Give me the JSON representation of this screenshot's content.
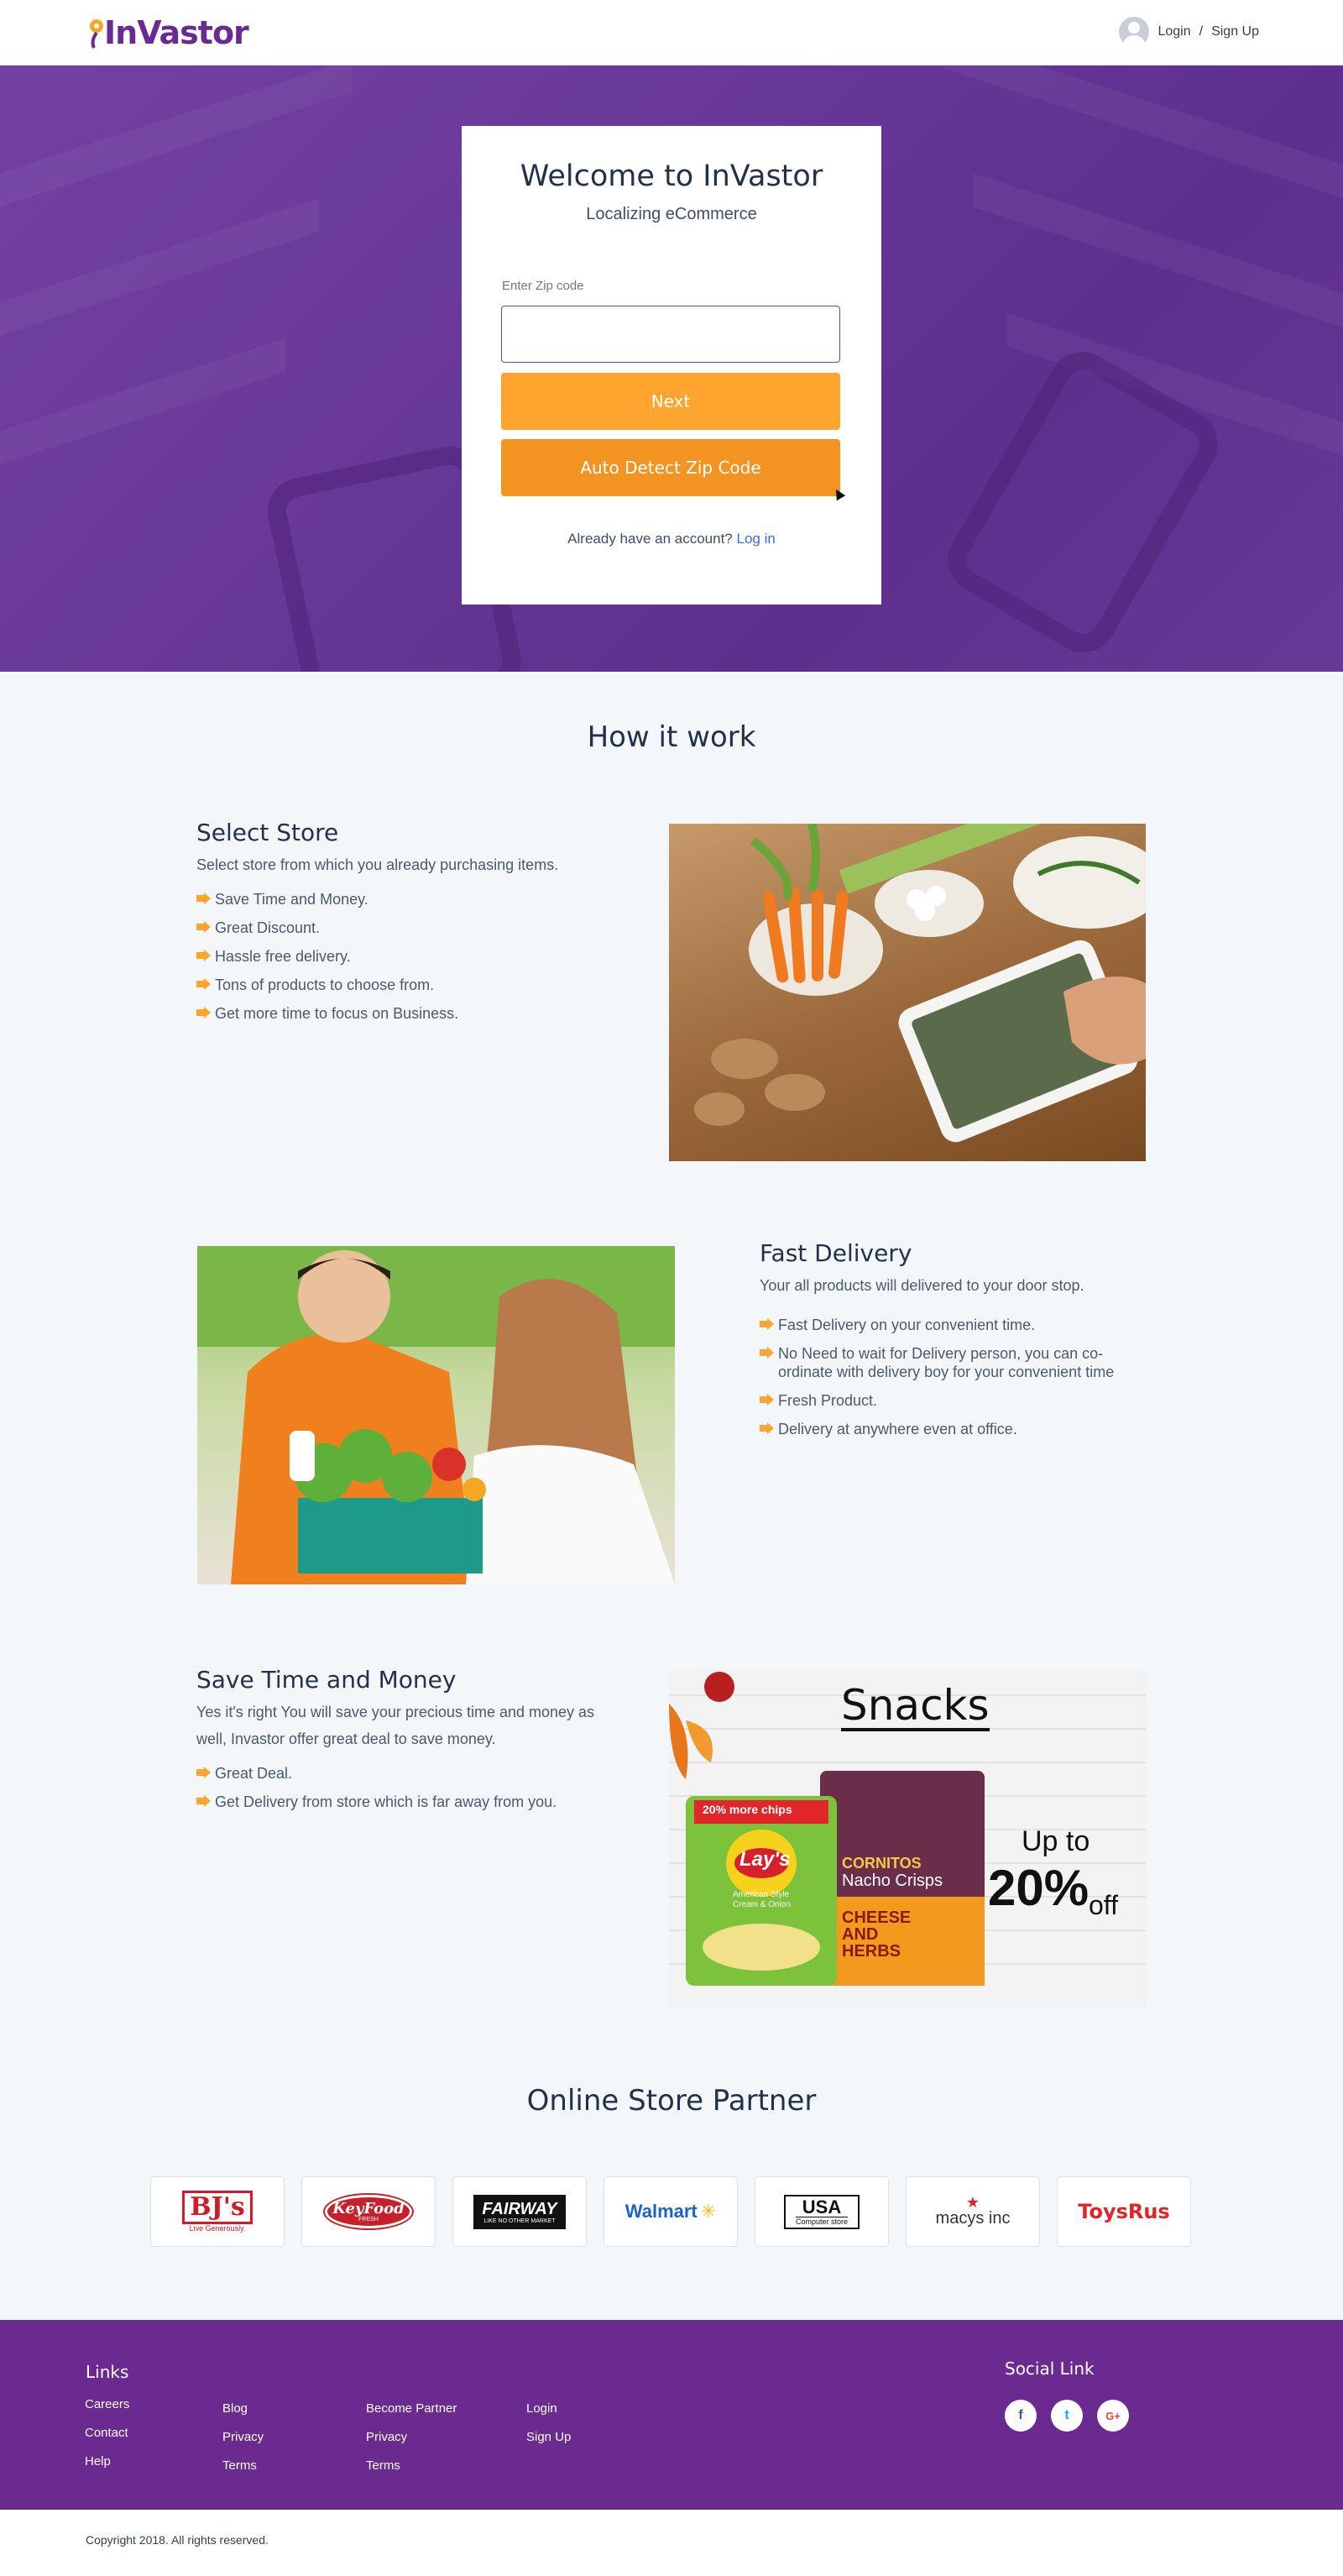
{
  "header": {
    "logo_text": "InVastor",
    "login_label": "Login",
    "separator": "/",
    "signup_label": "Sign Up"
  },
  "hero": {
    "title": "Welcome to InVastor",
    "subtitle": "Localizing eCommerce",
    "zip_label": "Enter Zip code",
    "zip_value": "",
    "next_label": "Next",
    "auto_detect_label": "Auto Detect Zip Code",
    "already_text": "Already have an account?",
    "login_link": "Log in"
  },
  "how_it_works": {
    "title": "How it work",
    "features": [
      {
        "title": "Select Store",
        "description": "Select store from which you already purchasing items.",
        "points": [
          "Save Time and Money.",
          "Great Discount.",
          "Hassle free delivery.",
          "Tons of products to choose from.",
          "Get more time to focus on Business."
        ]
      },
      {
        "title": "Fast Delivery",
        "description": "Your all products will delivered to your door stop.",
        "points": [
          "Fast Delivery on your convenient time.",
          "No Need to wait for Delivery person, you can co-ordinate with delivery boy for your convenient time",
          "Fresh Product.",
          "Delivery at anywhere even at office."
        ]
      },
      {
        "title": "Save Time and Money",
        "description": "Yes it's right You will save your precious time and money as well, Invastor offer great deal to save money.",
        "points": [
          "Great Deal.",
          "Get Delivery from store which is far away from you."
        ]
      }
    ],
    "snacks_banner": {
      "heading": "Snacks",
      "chips_tag": "20% more chips",
      "lays_brand": "Lay's",
      "lays_flavor": "American Style Cream & Onion",
      "cornitos_brand": "CORNITOS",
      "cornitos_product": "Nacho Crisps",
      "cornitos_flavor": "CHEESE AND HERBS",
      "offer_prefix": "Up to",
      "offer_value": "20%",
      "offer_suffix": "off"
    }
  },
  "partners": {
    "title": "Online Store Partner",
    "items": [
      {
        "name": "BJ's",
        "tagline": "Live Generously."
      },
      {
        "name": "KeyFood",
        "tagline": "FRESH"
      },
      {
        "name": "FAIRWAY",
        "tagline": "LIKE NO OTHER MARKET"
      },
      {
        "name": "Walmart",
        "tagline": ""
      },
      {
        "name": "USA",
        "tagline": "Computer store"
      },
      {
        "name": "macys inc",
        "tagline": ""
      },
      {
        "name": "ToysRus",
        "tagline": ""
      }
    ]
  },
  "footer": {
    "links_title": "Links",
    "col1": [
      "Careers",
      "Contact",
      "Help"
    ],
    "col2": [
      "Blog",
      "Privacy",
      "Terms"
    ],
    "col3": [
      "Become Partner",
      "Privacy",
      "Terms"
    ],
    "col4": [
      "Login",
      "Sign Up"
    ],
    "social_title": "Social Link",
    "social": [
      "f",
      "t",
      "G+"
    ],
    "copyright": "Copyright 2018. All rights reserved."
  },
  "colors": {
    "brand_purple": "#6b2a8f",
    "orange": "#ffa42e",
    "orange_dark": "#f39322"
  }
}
